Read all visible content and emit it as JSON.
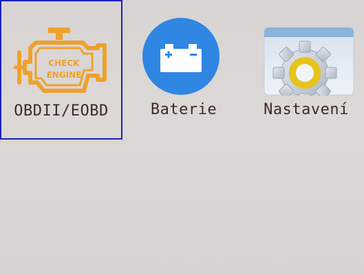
{
  "menu": {
    "items": [
      {
        "label": "OBDII/EOBD",
        "icon": "check-engine-icon",
        "icon_text": "CHECK\nENGINE",
        "selected": true
      },
      {
        "label": "Baterie",
        "icon": "battery-icon",
        "selected": false
      },
      {
        "label": "Nastavení",
        "icon": "settings-gear-icon",
        "selected": false
      }
    ]
  },
  "colors": {
    "selection_border": "#1b21b8",
    "engine_orange": "#eea12d",
    "battery_blue": "#2f86e3",
    "gear_yellow": "#e6c419",
    "label_text": "#3e2a26"
  }
}
